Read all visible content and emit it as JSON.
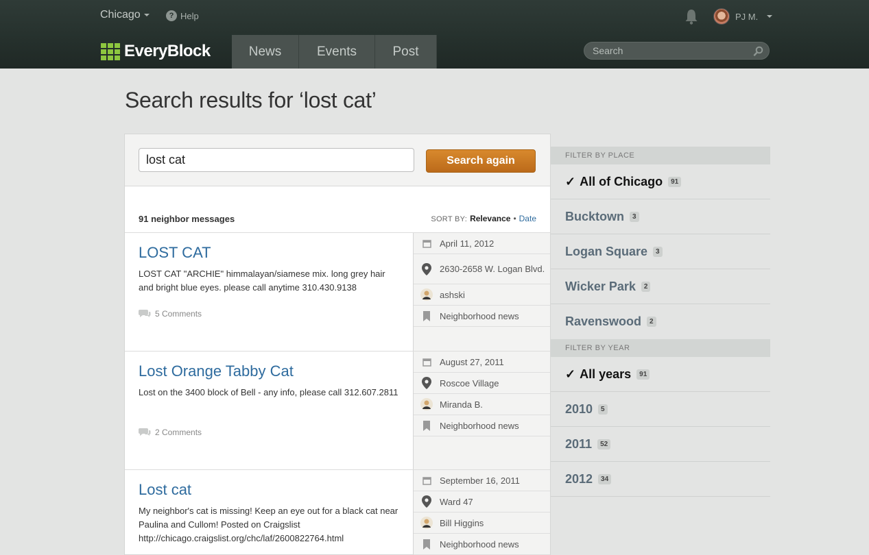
{
  "header": {
    "city": "Chicago",
    "help": "Help",
    "user": "PJ M.",
    "logo": "EveryBlock",
    "nav": [
      "News",
      "Events",
      "Post"
    ],
    "search_placeholder": "Search"
  },
  "page_title": "Search results for ‘lost cat’",
  "search": {
    "query": "lost cat",
    "button": "Search again"
  },
  "results_count": "91 neighbor messages",
  "sort": {
    "label": "SORT BY:",
    "relevance": "Relevance",
    "separator": "•",
    "date": "Date"
  },
  "results": [
    {
      "title": "LOST CAT",
      "body": "LOST CAT \"ARCHIE\" himmalayan/siamese mix. long grey hair and bright blue eyes. please call anytime 310.430.9138",
      "comments": "5 Comments",
      "date": "April 11, 2012",
      "location": "2630-2658 W. Logan Blvd.",
      "author": "ashski",
      "category": "Neighborhood news"
    },
    {
      "title": "Lost Orange Tabby Cat",
      "body": "Lost on the 3400 block of Bell - any info, please call 312.607.2811",
      "comments": "2 Comments",
      "date": "August 27, 2011",
      "location": "Roscoe Village",
      "author": "Miranda B.",
      "category": "Neighborhood news"
    },
    {
      "title": "Lost cat",
      "body": "My neighbor's cat is missing! Keep an eye out for a black cat near Paulina and Cullom! Posted on Craigslist http://chicago.craigslist.org/chc/laf/2600822764.html",
      "comments": "",
      "date": "September 16, 2011",
      "location": "Ward 47",
      "author": "Bill Higgins",
      "category": "Neighborhood news"
    }
  ],
  "filters": {
    "place_heading": "FILTER BY PLACE",
    "places": [
      {
        "label": "All of Chicago",
        "count": "91",
        "active": true
      },
      {
        "label": "Bucktown",
        "count": "3"
      },
      {
        "label": "Logan Square",
        "count": "3"
      },
      {
        "label": "Wicker Park",
        "count": "2"
      },
      {
        "label": "Ravenswood",
        "count": "2"
      }
    ],
    "year_heading": "FILTER BY YEAR",
    "years": [
      {
        "label": "All years",
        "count": "91",
        "active": true
      },
      {
        "label": "2010",
        "count": "5"
      },
      {
        "label": "2011",
        "count": "52"
      },
      {
        "label": "2012",
        "count": "34"
      }
    ],
    "check": "✓"
  },
  "colors": {
    "header_bg": "#25302c",
    "accent": "#c9782a",
    "link": "#2e6b9e",
    "logo_green": "#8dc63f"
  }
}
